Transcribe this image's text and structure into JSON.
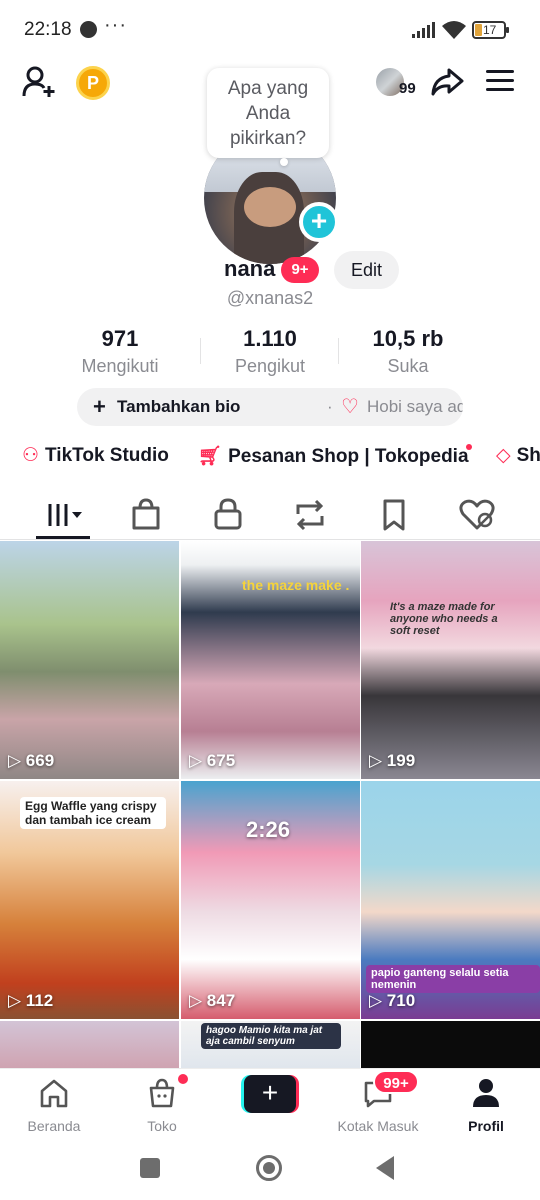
{
  "status_bar": {
    "time": "22:18",
    "more": "···",
    "battery": "17"
  },
  "header": {
    "p_coin": "P",
    "visitors_count": "99",
    "thought_bubble": "Apa yang Anda pikirkan?"
  },
  "profile": {
    "username": "nana",
    "name_badge": "9+",
    "edit_label": "Edit",
    "handle": "@xnanas2"
  },
  "stats": [
    {
      "value": "971",
      "label": "Mengikuti"
    },
    {
      "value": "1.110",
      "label": "Pengikut"
    },
    {
      "value": "10,5 rb",
      "label": "Suka"
    }
  ],
  "bio": {
    "add_label": "Tambahkan bio",
    "separator": "·",
    "hobby_text": "Hobi saya adalah..."
  },
  "shortcuts": [
    {
      "label": "TikTok Studio"
    },
    {
      "label": "Pesanan Shop | Tokopedia"
    },
    {
      "label": "Sh"
    }
  ],
  "tabs": [
    "videos",
    "shop",
    "private",
    "reposts",
    "saved",
    "liked"
  ],
  "videos": [
    {
      "views": "669"
    },
    {
      "views": "675",
      "caption": "the maze make ."
    },
    {
      "views": "199",
      "caption": "It's a maze made for anyone who needs a soft reset"
    },
    {
      "views": "112",
      "caption": "Egg Waffle yang crispy dan tambah ice cream"
    },
    {
      "views": "847",
      "caption": "2:26"
    },
    {
      "views": "710",
      "caption": "papio ganteng selalu setia nemenin"
    },
    {
      "views": "",
      "caption": ""
    },
    {
      "views": "",
      "caption": "hagoo Mamio kita ma jat aja cambil senyum"
    },
    {
      "views": "",
      "caption": ""
    }
  ],
  "bottom_nav": {
    "home": "Beranda",
    "shop": "Toko",
    "inbox": "Kotak Masuk",
    "inbox_badge": "99+",
    "profile": "Profil",
    "create": "+"
  },
  "colors": {
    "accent": "#fe2c55",
    "cyan": "#20c4d8",
    "text": "#161823",
    "muted": "#8a8b91"
  }
}
